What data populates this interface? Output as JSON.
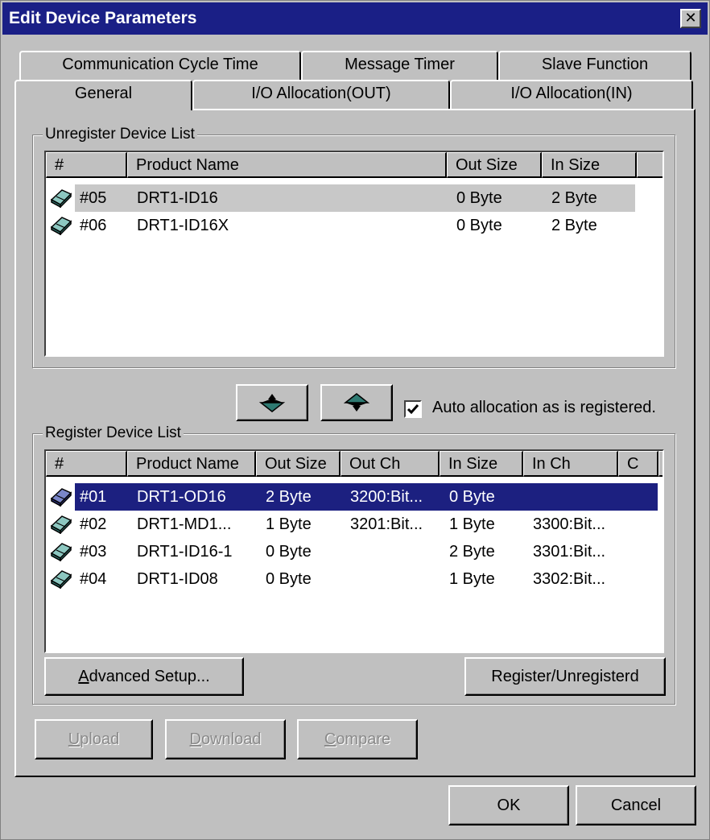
{
  "window": {
    "title": "Edit Device Parameters",
    "close_glyph": "✕"
  },
  "tabs": {
    "back_row": [
      "Communication Cycle Time",
      "Message Timer",
      "Slave Function"
    ],
    "front_row": [
      "General",
      "I/O Allocation(OUT)",
      "I/O Allocation(IN)"
    ],
    "active": "General"
  },
  "unregister": {
    "label": "Unregister Device List",
    "columns": [
      "#",
      "Product Name",
      "Out Size",
      "In Size"
    ],
    "rows": [
      {
        "id": "#05",
        "name": "DRT1-ID16",
        "out_size": "0 Byte",
        "in_size": "2 Byte",
        "state": "gray-selected"
      },
      {
        "id": "#06",
        "name": "DRT1-ID16X",
        "out_size": "0 Byte",
        "in_size": "2 Byte",
        "state": "normal"
      }
    ]
  },
  "transfer": {
    "register_icon": "arrow-down-icon",
    "unregister_icon": "arrow-up-icon",
    "auto_alloc_label": "Auto allocation as is registered.",
    "auto_alloc_checked": true
  },
  "register": {
    "label": "Register Device List",
    "columns": [
      "#",
      "Product Name",
      "Out Size",
      "Out Ch",
      "In Size",
      "In Ch",
      "C"
    ],
    "rows": [
      {
        "id": "#01",
        "name": "DRT1-OD16",
        "out_size": "2 Byte",
        "out_ch": "3200:Bit...",
        "in_size": "0 Byte",
        "in_ch": "",
        "state": "selected"
      },
      {
        "id": "#02",
        "name": "DRT1-MD1...",
        "out_size": "1 Byte",
        "out_ch": "3201:Bit...",
        "in_size": "1 Byte",
        "in_ch": "3300:Bit...",
        "state": "normal"
      },
      {
        "id": "#03",
        "name": "DRT1-ID16-1",
        "out_size": "0 Byte",
        "out_ch": "",
        "in_size": "2 Byte",
        "in_ch": "3301:Bit...",
        "state": "normal"
      },
      {
        "id": "#04",
        "name": "DRT1-ID08",
        "out_size": "0 Byte",
        "out_ch": "",
        "in_size": "1 Byte",
        "in_ch": "3302:Bit...",
        "state": "normal"
      }
    ],
    "advanced_setup": "Advanced Setup...",
    "register_unregister": "Register/Unregisterd"
  },
  "actions": {
    "upload": "Upload",
    "download": "Download",
    "compare": "Compare"
  },
  "footer": {
    "ok": "OK",
    "cancel": "Cancel"
  },
  "colors": {
    "title_bar": "#1a1f86",
    "selection": "#1c2080",
    "face": "#c0c0c0"
  }
}
